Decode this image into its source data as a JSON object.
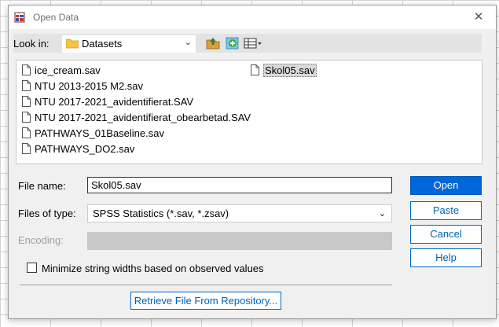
{
  "window": {
    "title": "Open Data",
    "close_glyph": "✕"
  },
  "lookin": {
    "label": "Look in:",
    "value": "Datasets"
  },
  "files": [
    {
      "name": "ice_cream.sav"
    },
    {
      "name": "NTU 2013-2015 M2.sav"
    },
    {
      "name": "NTU 2017-2021_avidentifierat.SAV"
    },
    {
      "name": "NTU 2017-2021_avidentifierat_obearbetad.SAV"
    },
    {
      "name": "PATHWAYS_01Baseline.sav"
    },
    {
      "name": "PATHWAYS_DO2.sav"
    },
    {
      "name": "Skol05.sav"
    }
  ],
  "filename": {
    "label": "File name:",
    "value": "Skol05.sav"
  },
  "filetype": {
    "label": "Files of type:",
    "value": "SPSS Statistics (*.sav, *.zsav)"
  },
  "encoding": {
    "label": "Encoding:"
  },
  "minimize": {
    "label": "Minimize string widths based on observed values",
    "checked": false
  },
  "buttons": {
    "open": "Open",
    "paste": "Paste",
    "cancel": "Cancel",
    "help": "Help"
  },
  "retrieve_label": "Retrieve File From Repository...",
  "icons": {
    "app": "spss-app-icon",
    "folder": "folder-icon",
    "up": "up-folder-icon",
    "new_folder": "new-folder-icon",
    "view": "view-menu-icon",
    "file": "document-icon"
  },
  "colors": {
    "accent": "#0067d9",
    "selected": "#d9d9d9"
  }
}
